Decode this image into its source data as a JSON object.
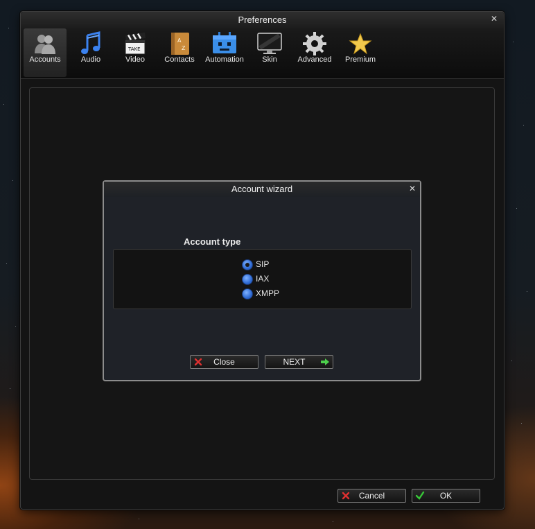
{
  "window": {
    "title": "Preferences",
    "close_glyph": "✕"
  },
  "toolbar": {
    "items": [
      {
        "label": "Accounts",
        "icon": "accounts-icon",
        "active": true
      },
      {
        "label": "Audio",
        "icon": "music-note-icon",
        "active": false
      },
      {
        "label": "Video",
        "icon": "clapperboard-icon",
        "active": false
      },
      {
        "label": "Contacts",
        "icon": "address-book-icon",
        "active": false
      },
      {
        "label": "Automation",
        "icon": "robot-icon",
        "active": false
      },
      {
        "label": "Skin",
        "icon": "monitor-icon",
        "active": false
      },
      {
        "label": "Advanced",
        "icon": "gear-icon",
        "active": false
      },
      {
        "label": "Premium",
        "icon": "star-icon",
        "active": false
      }
    ],
    "clapper_text": "TAKE"
  },
  "dialog": {
    "title": "Account wizard",
    "close_glyph": "✕",
    "section_label": "Account type",
    "options": [
      {
        "label": "SIP",
        "selected": true
      },
      {
        "label": "IAX",
        "selected": false
      },
      {
        "label": "XMPP",
        "selected": false
      }
    ],
    "close_button": "Close",
    "next_button": "NEXT"
  },
  "footer": {
    "cancel_button": "Cancel",
    "ok_button": "OK"
  },
  "colors": {
    "radio_blue": "#3a78e0",
    "cancel_red": "#e03030",
    "ok_green": "#38c838",
    "next_green": "#4cd04c"
  }
}
